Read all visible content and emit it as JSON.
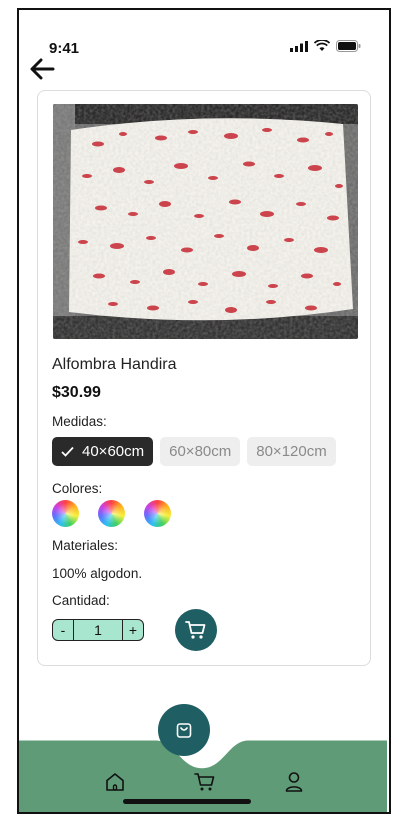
{
  "status_bar": {
    "time": "9:41"
  },
  "product": {
    "name": "Alfombra Handira",
    "price": "$30.99",
    "image_alt": "Alfombra blanca con motas rojas",
    "sizes_label": "Medidas:",
    "sizes": [
      {
        "label": "40×60cm",
        "selected": true
      },
      {
        "label": "60×80cm",
        "selected": false
      },
      {
        "label": "80×120cm",
        "selected": false
      }
    ],
    "colors_label": "Colores:",
    "materials_label": "Materiales:",
    "materials_value": "100% algodon.",
    "quantity_label": "Cantidad:",
    "quantity": {
      "minus": "-",
      "value": "1",
      "plus": "+"
    }
  },
  "nav": {
    "items": [
      "home-icon",
      "cart-icon",
      "user-icon"
    ],
    "active": "cart-icon",
    "fab_icon": "bag-icon"
  },
  "colors": {
    "accent_dark": "#1f5e63",
    "nav_green": "#5f9b77",
    "qty_bg": "#a8e6cf",
    "selected_chip": "#2a2a2a"
  }
}
